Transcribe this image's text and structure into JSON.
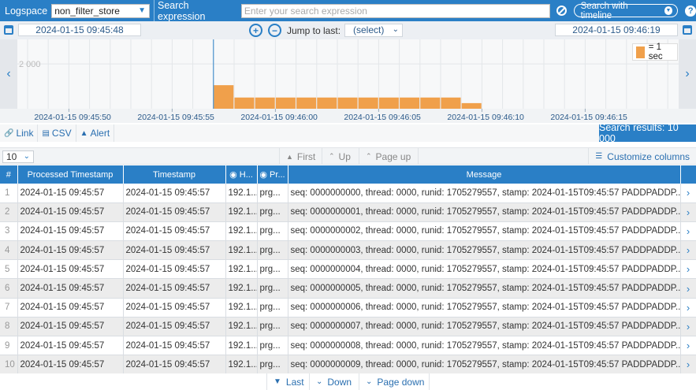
{
  "topbar": {
    "logspace_label": "Logspace",
    "logspace_value": "non_filter_store",
    "search_label": "Search expression",
    "search_placeholder": "Enter your search expression",
    "timeline_button": "Search with timeline",
    "help_label": "?"
  },
  "timerange": {
    "start": "2024-01-15 09:45:48",
    "end": "2024-01-15 09:46:19",
    "jump_label": "Jump to last:",
    "jump_value": "(select)"
  },
  "chart_data": {
    "type": "bar",
    "y_tick_label": "2 000",
    "legend_label": "= 1 sec",
    "bar_color": "#f0a04b",
    "x_tick_labels": [
      "2024-01-15 09:45:50",
      "2024-01-15 09:45:55",
      "2024-01-15 09:46:00",
      "2024-01-15 09:46:05",
      "2024-01-15 09:46:10",
      "2024-01-15 09:46:15"
    ],
    "bars": [
      {
        "time": "2024-01-15 09:45:57",
        "value": 1050
      },
      {
        "time": "2024-01-15 09:45:58",
        "value": 500
      },
      {
        "time": "2024-01-15 09:45:59",
        "value": 500
      },
      {
        "time": "2024-01-15 09:46:00",
        "value": 500
      },
      {
        "time": "2024-01-15 09:46:01",
        "value": 500
      },
      {
        "time": "2024-01-15 09:46:02",
        "value": 500
      },
      {
        "time": "2024-01-15 09:46:03",
        "value": 500
      },
      {
        "time": "2024-01-15 09:46:04",
        "value": 500
      },
      {
        "time": "2024-01-15 09:46:05",
        "value": 500
      },
      {
        "time": "2024-01-15 09:46:06",
        "value": 500
      },
      {
        "time": "2024-01-15 09:46:07",
        "value": 500
      },
      {
        "time": "2024-01-15 09:46:08",
        "value": 500
      },
      {
        "time": "2024-01-15 09:46:09",
        "value": 250
      }
    ]
  },
  "actions": {
    "link": "Link",
    "csv": "CSV",
    "alert": "Alert",
    "results": "Search results: 10 000"
  },
  "pager": {
    "page_size": "10",
    "first": "First",
    "up": "Up",
    "page_up": "Page up",
    "customize": "Customize columns",
    "last": "Last",
    "down": "Down",
    "page_down": "Page down"
  },
  "table": {
    "headers": [
      "#",
      "Processed Timestamp",
      "Timestamp",
      "H...",
      "Pr...",
      "Message"
    ],
    "rows": [
      {
        "num": "1",
        "processed": "2024-01-15 09:45:57",
        "timestamp": "2024-01-15 09:45:57",
        "host": "192.1...",
        "proc": "prg...",
        "message": "seq: 0000000000, thread: 0000, runid: 1705279557, stamp: 2024-01-15T09:45:57 PADDPADDP..."
      },
      {
        "num": "2",
        "processed": "2024-01-15 09:45:57",
        "timestamp": "2024-01-15 09:45:57",
        "host": "192.1...",
        "proc": "prg...",
        "message": "seq: 0000000001, thread: 0000, runid: 1705279557, stamp: 2024-01-15T09:45:57 PADDPADDP..."
      },
      {
        "num": "3",
        "processed": "2024-01-15 09:45:57",
        "timestamp": "2024-01-15 09:45:57",
        "host": "192.1...",
        "proc": "prg...",
        "message": "seq: 0000000002, thread: 0000, runid: 1705279557, stamp: 2024-01-15T09:45:57 PADDPADDP..."
      },
      {
        "num": "4",
        "processed": "2024-01-15 09:45:57",
        "timestamp": "2024-01-15 09:45:57",
        "host": "192.1...",
        "proc": "prg...",
        "message": "seq: 0000000003, thread: 0000, runid: 1705279557, stamp: 2024-01-15T09:45:57 PADDPADDP..."
      },
      {
        "num": "5",
        "processed": "2024-01-15 09:45:57",
        "timestamp": "2024-01-15 09:45:57",
        "host": "192.1...",
        "proc": "prg...",
        "message": "seq: 0000000004, thread: 0000, runid: 1705279557, stamp: 2024-01-15T09:45:57 PADDPADDP..."
      },
      {
        "num": "6",
        "processed": "2024-01-15 09:45:57",
        "timestamp": "2024-01-15 09:45:57",
        "host": "192.1...",
        "proc": "prg...",
        "message": "seq: 0000000005, thread: 0000, runid: 1705279557, stamp: 2024-01-15T09:45:57 PADDPADDP..."
      },
      {
        "num": "7",
        "processed": "2024-01-15 09:45:57",
        "timestamp": "2024-01-15 09:45:57",
        "host": "192.1...",
        "proc": "prg...",
        "message": "seq: 0000000006, thread: 0000, runid: 1705279557, stamp: 2024-01-15T09:45:57 PADDPADDP..."
      },
      {
        "num": "8",
        "processed": "2024-01-15 09:45:57",
        "timestamp": "2024-01-15 09:45:57",
        "host": "192.1...",
        "proc": "prg...",
        "message": "seq: 0000000007, thread: 0000, runid: 1705279557, stamp: 2024-01-15T09:45:57 PADDPADDP..."
      },
      {
        "num": "9",
        "processed": "2024-01-15 09:45:57",
        "timestamp": "2024-01-15 09:45:57",
        "host": "192.1...",
        "proc": "prg...",
        "message": "seq: 0000000008, thread: 0000, runid: 1705279557, stamp: 2024-01-15T09:45:57 PADDPADDP..."
      },
      {
        "num": "10",
        "processed": "2024-01-15 09:45:57",
        "timestamp": "2024-01-15 09:45:57",
        "host": "192.1...",
        "proc": "prg...",
        "message": "seq: 0000000009, thread: 0000, runid: 1705279557, stamp: 2024-01-15T09:45:57 PADDPADDP..."
      }
    ]
  }
}
